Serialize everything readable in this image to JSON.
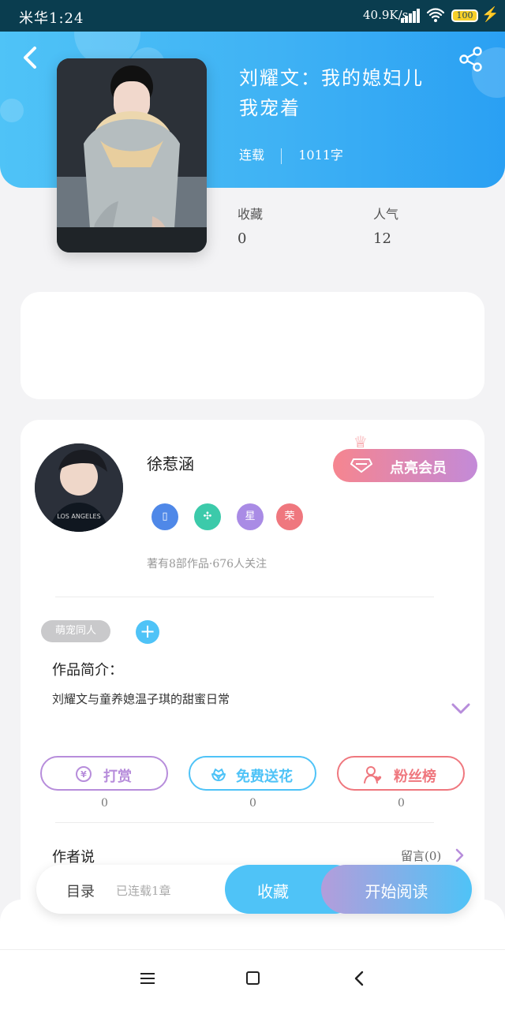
{
  "status_bar": {
    "carrier": "米华1:24",
    "network_speed": "40.9K/s",
    "battery_level": "100"
  },
  "header": {
    "title_line1": "刘耀文：我的媳妇儿",
    "title_line2": "我宠着",
    "status": "连载",
    "word_count": "1011字",
    "collect_label": "收藏",
    "collect_count": "0",
    "popularity_label": "人气",
    "popularity_count": "12"
  },
  "author": {
    "name": "徐惹涵",
    "badges": [
      "phone-icon",
      "handshake-icon",
      "星",
      "荣"
    ],
    "vip_button": "点亮会员",
    "stats_text": "著有8部作品·676人关注",
    "tag": "萌宠同人",
    "intro_title": "作品简介：",
    "intro_text": "刘耀文与童养媳温子琪的甜蜜日常"
  },
  "actions": {
    "reward_label": "打赏",
    "reward_count": "0",
    "flower_label": "免费送花",
    "flower_count": "0",
    "fans_label": "粉丝榜",
    "fans_count": "0"
  },
  "author_section": {
    "title": "作者说",
    "message_link": "留言(0)"
  },
  "toolbar": {
    "toc": "目录",
    "toc_status": "已连载1章",
    "collect": "收藏",
    "read": "开始阅读"
  },
  "colors": {
    "brand_blue": "#4fc3f7",
    "vip_gradient_start": "#f6858f",
    "vip_gradient_end": "#c38ad8",
    "flower_accent": "#4fc3f7",
    "fans_accent": "#ef777e",
    "reward_accent": "#b78ddb"
  }
}
